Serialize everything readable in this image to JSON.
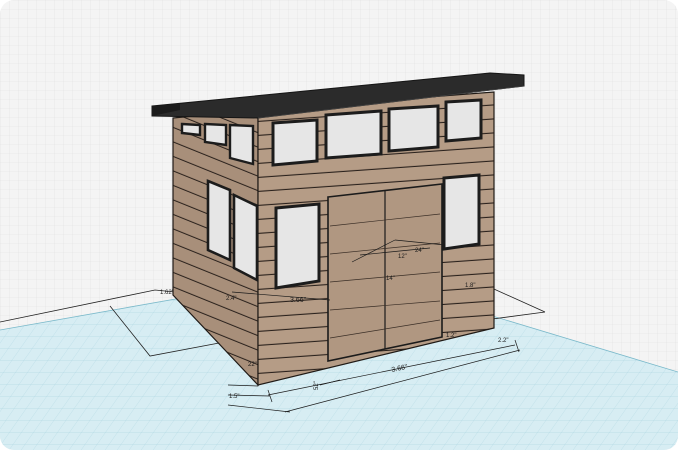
{
  "scene": {
    "model": "shed-3d-model",
    "colors": {
      "background": "#f4f4f4",
      "grid_line": "#dedede",
      "ground_plane": "#d8eef4",
      "ground_grid": "#a9d3df",
      "siding": "#b39a85",
      "siding_dark": "#9c8370",
      "siding_line": "#2a211c",
      "roof": "#2b2b2b",
      "window_glass": "#e6e6e6",
      "window_frame": "#1c1c1c"
    }
  },
  "dimensions": {
    "width_main": "3.66\"",
    "width_mid": "3.66\"",
    "height_left": "52\"",
    "small_a": "1.62\"",
    "small_b": "2.4\"",
    "small_c": "1.5\"",
    "small_d": "2.2\"",
    "small_e": "1.2\"",
    "small_f": "14\"",
    "small_g": "12\"",
    "small_h": "1.8\"",
    "small_i": "22\"",
    "small_j": "24\""
  }
}
